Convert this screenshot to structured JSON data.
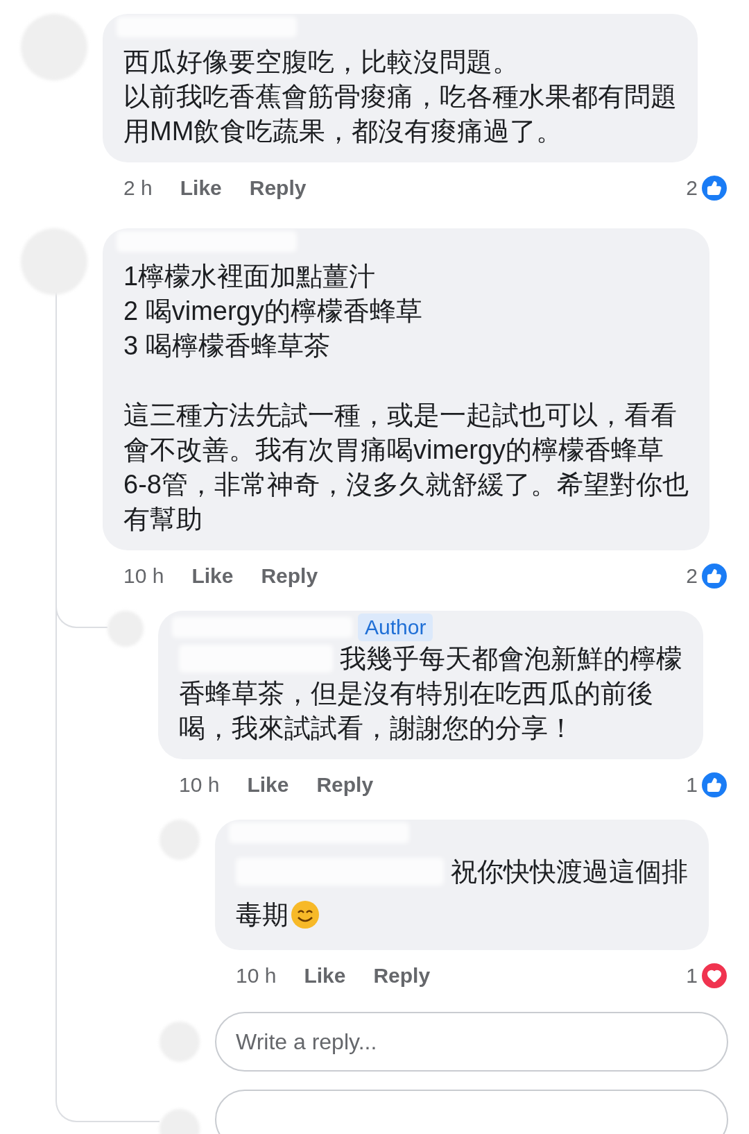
{
  "comments": [
    {
      "name_hidden": true,
      "paragraphs": [
        [
          "西瓜好像要空腹吃，比較沒問題。",
          "以前我吃香蕉會筋骨痠痛，吃各種水果都有問題",
          "用MM飲食吃蔬果，都沒有痠痛過了。"
        ]
      ],
      "time": "2 h",
      "actions": [
        "Like",
        "Reply"
      ],
      "reaction": {
        "kind": "like",
        "count": "2"
      }
    },
    {
      "name_hidden": true,
      "paragraphs": [
        [
          "1檸檬水裡面加點薑汁",
          "2 喝vimergy的檸檬香蜂草",
          "3 喝檸檬香蜂草茶"
        ],
        [
          "這三種方法先試一種，或是一起試也可以，看看",
          "會不改善。我有次胃痛喝vimergy的檸檬香蜂草",
          "6-8管，非常神奇，沒多久就舒緩了。希望對你也",
          "有幫助"
        ]
      ],
      "time": "10 h",
      "actions": [
        "Like",
        "Reply"
      ],
      "reaction": {
        "kind": "like",
        "count": "2"
      },
      "replies": [
        {
          "name_hidden": true,
          "badge": "Author",
          "mention_hidden": true,
          "paragraphs": [
            [
              "我幾乎每天都會泡新鮮的檸檬",
              "香蜂草茶，但是沒有特別在吃西瓜的前後",
              "喝，我來試試看，謝謝您的分享！"
            ]
          ],
          "time": "10 h",
          "actions": [
            "Like",
            "Reply"
          ],
          "reaction": {
            "kind": "like",
            "count": "1"
          },
          "replies": [
            {
              "name_hidden": true,
              "mention_hidden": true,
              "paragraphs": [
                [
                  "祝你快快渡過這個排",
                  "毒期"
                ]
              ],
              "has_emoji": true,
              "time": "10 h",
              "actions": [
                "Like",
                "Reply"
              ],
              "reaction": {
                "kind": "love",
                "count": "1"
              }
            }
          ],
          "reply_field": {
            "placeholder": "Write a reply..."
          }
        }
      ],
      "reply_field": {
        "cut_off": true
      }
    }
  ]
}
